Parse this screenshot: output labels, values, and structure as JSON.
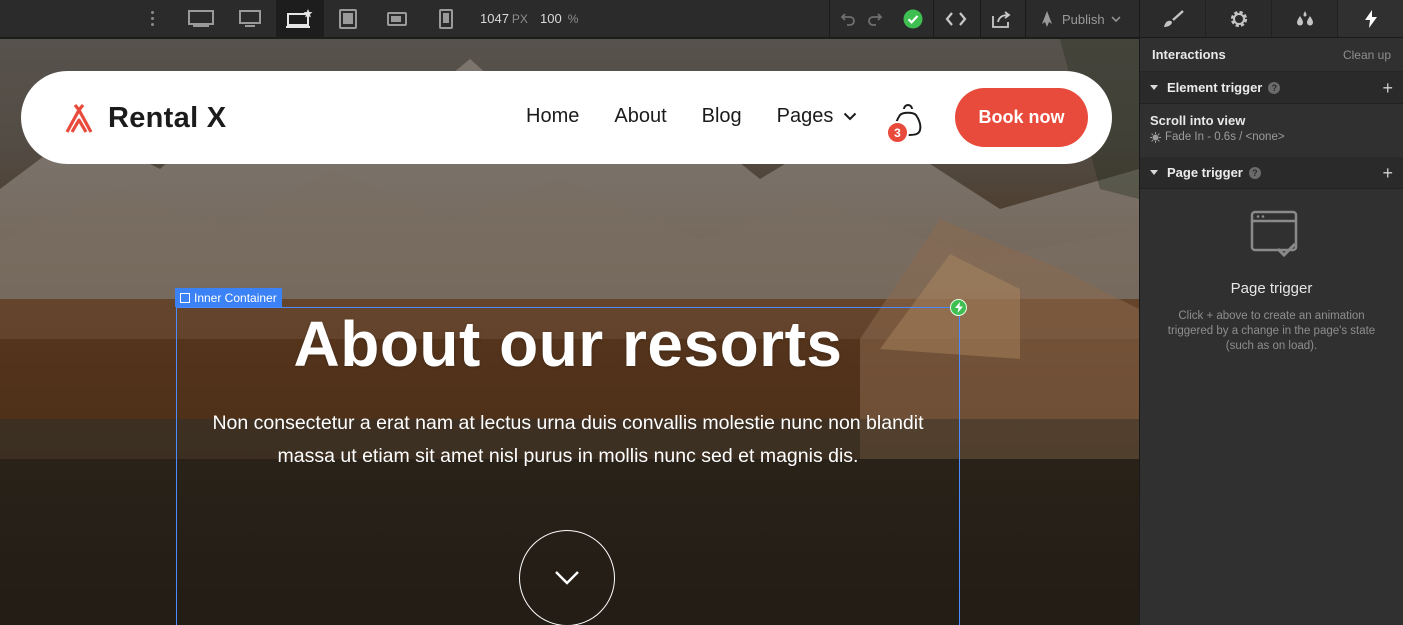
{
  "toolbar": {
    "width_value": "1047",
    "width_unit": "PX",
    "zoom_value": "100",
    "zoom_unit": "%",
    "publish_label": "Publish",
    "breakpoints": [
      "desktop-xl",
      "desktop-large",
      "desktop-base",
      "tablet",
      "mobile-landscape",
      "mobile-portrait"
    ],
    "active_breakpoint": "desktop-base"
  },
  "panel": {
    "tabs": [
      "style",
      "settings",
      "style-manager",
      "interactions"
    ],
    "active_tab": "interactions",
    "title": "Interactions",
    "cleanup_label": "Clean up",
    "element_trigger": {
      "title": "Element trigger",
      "help": "?",
      "add": "+",
      "trigger_name": "Scroll into view",
      "trigger_detail": "Fade In - 0.6s / <none>"
    },
    "page_trigger": {
      "title": "Page trigger",
      "help": "?",
      "add": "+",
      "empty_title": "Page trigger",
      "empty_desc": "Click + above to create an animation triggered by a change in the page's state (such as on load)."
    }
  },
  "site": {
    "brand": "Rental X",
    "nav": [
      {
        "label": "Home"
      },
      {
        "label": "About"
      },
      {
        "label": "Blog"
      },
      {
        "label": "Pages"
      }
    ],
    "cart_count": "3",
    "cta_label": "Book now",
    "hero_title": "About our resorts",
    "hero_subtitle": "Non consectetur a erat nam at lectus urna duis convallis molestie nunc non blandit massa ut etiam sit amet nisl purus in mollis nunc sed et magnis dis.",
    "accent_color": "#e84b3c"
  },
  "selection": {
    "label": "Inner Container",
    "color": "#3b82f6"
  }
}
